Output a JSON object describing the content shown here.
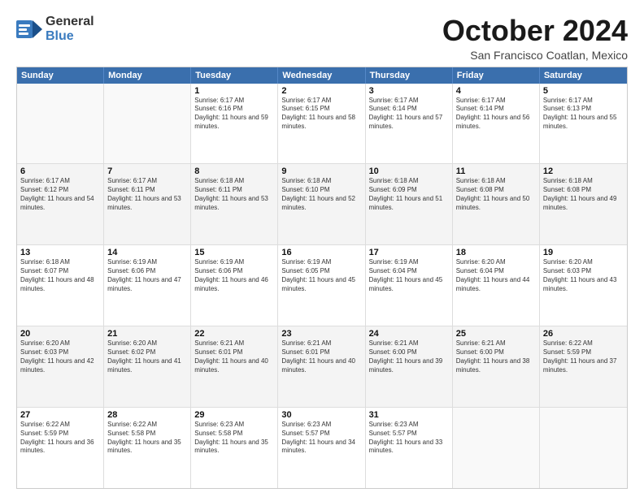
{
  "header": {
    "logo_general": "General",
    "logo_blue": "Blue",
    "month": "October 2024",
    "location": "San Francisco Coatlan, Mexico"
  },
  "weekdays": [
    "Sunday",
    "Monday",
    "Tuesday",
    "Wednesday",
    "Thursday",
    "Friday",
    "Saturday"
  ],
  "rows": [
    [
      {
        "day": "",
        "info": ""
      },
      {
        "day": "",
        "info": ""
      },
      {
        "day": "1",
        "info": "Sunrise: 6:17 AM\nSunset: 6:16 PM\nDaylight: 11 hours and 59 minutes."
      },
      {
        "day": "2",
        "info": "Sunrise: 6:17 AM\nSunset: 6:15 PM\nDaylight: 11 hours and 58 minutes."
      },
      {
        "day": "3",
        "info": "Sunrise: 6:17 AM\nSunset: 6:14 PM\nDaylight: 11 hours and 57 minutes."
      },
      {
        "day": "4",
        "info": "Sunrise: 6:17 AM\nSunset: 6:14 PM\nDaylight: 11 hours and 56 minutes."
      },
      {
        "day": "5",
        "info": "Sunrise: 6:17 AM\nSunset: 6:13 PM\nDaylight: 11 hours and 55 minutes."
      }
    ],
    [
      {
        "day": "6",
        "info": "Sunrise: 6:17 AM\nSunset: 6:12 PM\nDaylight: 11 hours and 54 minutes."
      },
      {
        "day": "7",
        "info": "Sunrise: 6:17 AM\nSunset: 6:11 PM\nDaylight: 11 hours and 53 minutes."
      },
      {
        "day": "8",
        "info": "Sunrise: 6:18 AM\nSunset: 6:11 PM\nDaylight: 11 hours and 53 minutes."
      },
      {
        "day": "9",
        "info": "Sunrise: 6:18 AM\nSunset: 6:10 PM\nDaylight: 11 hours and 52 minutes."
      },
      {
        "day": "10",
        "info": "Sunrise: 6:18 AM\nSunset: 6:09 PM\nDaylight: 11 hours and 51 minutes."
      },
      {
        "day": "11",
        "info": "Sunrise: 6:18 AM\nSunset: 6:08 PM\nDaylight: 11 hours and 50 minutes."
      },
      {
        "day": "12",
        "info": "Sunrise: 6:18 AM\nSunset: 6:08 PM\nDaylight: 11 hours and 49 minutes."
      }
    ],
    [
      {
        "day": "13",
        "info": "Sunrise: 6:18 AM\nSunset: 6:07 PM\nDaylight: 11 hours and 48 minutes."
      },
      {
        "day": "14",
        "info": "Sunrise: 6:19 AM\nSunset: 6:06 PM\nDaylight: 11 hours and 47 minutes."
      },
      {
        "day": "15",
        "info": "Sunrise: 6:19 AM\nSunset: 6:06 PM\nDaylight: 11 hours and 46 minutes."
      },
      {
        "day": "16",
        "info": "Sunrise: 6:19 AM\nSunset: 6:05 PM\nDaylight: 11 hours and 45 minutes."
      },
      {
        "day": "17",
        "info": "Sunrise: 6:19 AM\nSunset: 6:04 PM\nDaylight: 11 hours and 45 minutes."
      },
      {
        "day": "18",
        "info": "Sunrise: 6:20 AM\nSunset: 6:04 PM\nDaylight: 11 hours and 44 minutes."
      },
      {
        "day": "19",
        "info": "Sunrise: 6:20 AM\nSunset: 6:03 PM\nDaylight: 11 hours and 43 minutes."
      }
    ],
    [
      {
        "day": "20",
        "info": "Sunrise: 6:20 AM\nSunset: 6:03 PM\nDaylight: 11 hours and 42 minutes."
      },
      {
        "day": "21",
        "info": "Sunrise: 6:20 AM\nSunset: 6:02 PM\nDaylight: 11 hours and 41 minutes."
      },
      {
        "day": "22",
        "info": "Sunrise: 6:21 AM\nSunset: 6:01 PM\nDaylight: 11 hours and 40 minutes."
      },
      {
        "day": "23",
        "info": "Sunrise: 6:21 AM\nSunset: 6:01 PM\nDaylight: 11 hours and 40 minutes."
      },
      {
        "day": "24",
        "info": "Sunrise: 6:21 AM\nSunset: 6:00 PM\nDaylight: 11 hours and 39 minutes."
      },
      {
        "day": "25",
        "info": "Sunrise: 6:21 AM\nSunset: 6:00 PM\nDaylight: 11 hours and 38 minutes."
      },
      {
        "day": "26",
        "info": "Sunrise: 6:22 AM\nSunset: 5:59 PM\nDaylight: 11 hours and 37 minutes."
      }
    ],
    [
      {
        "day": "27",
        "info": "Sunrise: 6:22 AM\nSunset: 5:59 PM\nDaylight: 11 hours and 36 minutes."
      },
      {
        "day": "28",
        "info": "Sunrise: 6:22 AM\nSunset: 5:58 PM\nDaylight: 11 hours and 35 minutes."
      },
      {
        "day": "29",
        "info": "Sunrise: 6:23 AM\nSunset: 5:58 PM\nDaylight: 11 hours and 35 minutes."
      },
      {
        "day": "30",
        "info": "Sunrise: 6:23 AM\nSunset: 5:57 PM\nDaylight: 11 hours and 34 minutes."
      },
      {
        "day": "31",
        "info": "Sunrise: 6:23 AM\nSunset: 5:57 PM\nDaylight: 11 hours and 33 minutes."
      },
      {
        "day": "",
        "info": ""
      },
      {
        "day": "",
        "info": ""
      }
    ]
  ]
}
